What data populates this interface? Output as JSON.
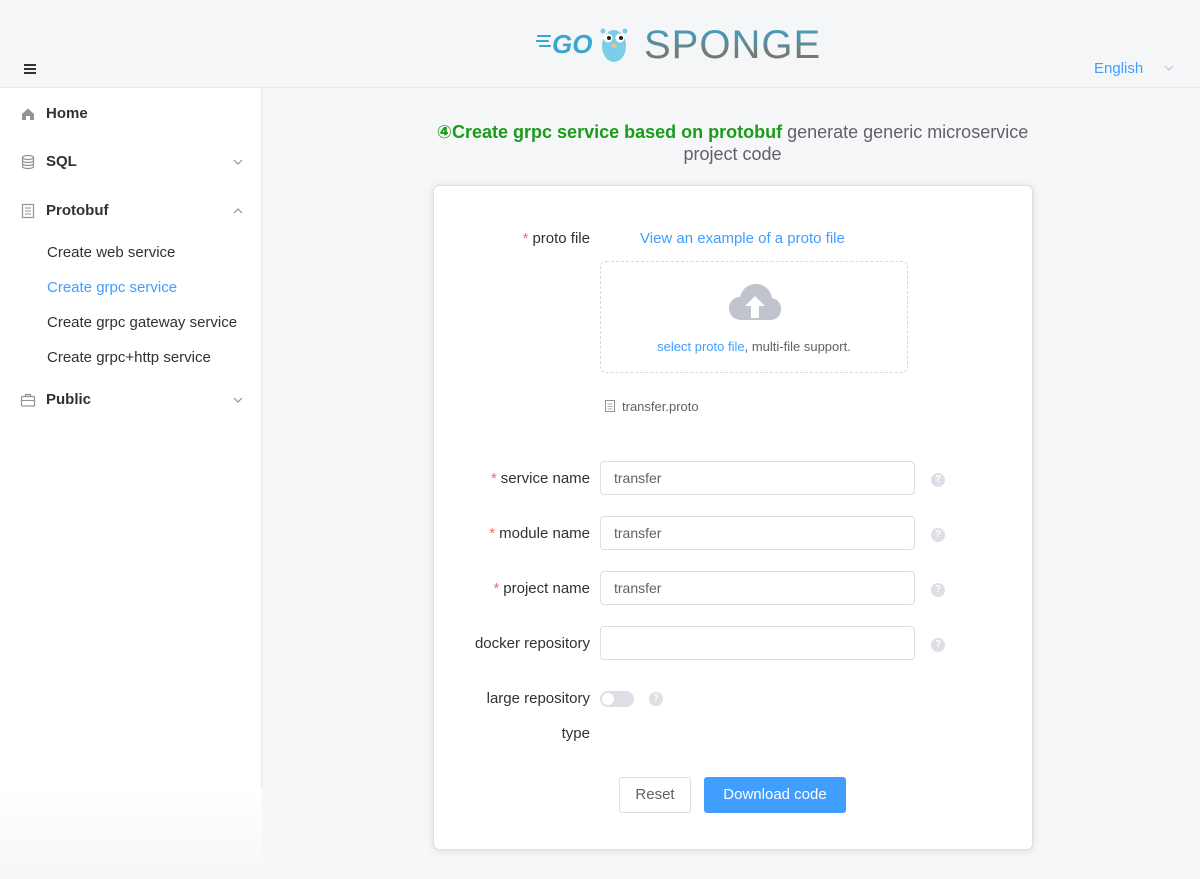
{
  "header": {
    "logo": {
      "go_text": "GO",
      "brand_text": "SPONGE"
    },
    "language": "English"
  },
  "sidebar": {
    "items": [
      {
        "label": "Home",
        "icon": "home-icon"
      },
      {
        "label": "SQL",
        "icon": "database-icon",
        "expanded": false
      },
      {
        "label": "Protobuf",
        "icon": "document-icon",
        "expanded": true,
        "children": [
          {
            "label": "Create web service"
          },
          {
            "label": "Create grpc service",
            "active": true
          },
          {
            "label": "Create grpc gateway service"
          },
          {
            "label": "Create grpc+http service"
          }
        ]
      },
      {
        "label": "Public",
        "icon": "briefcase-icon",
        "expanded": false
      }
    ]
  },
  "main": {
    "heading_highlight": "④Create grpc service based on protobuf",
    "heading_rest": " generate generic microservice project code",
    "form": {
      "proto_file_label": "proto file",
      "example_link": "View an example of a proto file",
      "upload_link": "select proto file",
      "upload_hint": ", multi-file support.",
      "uploaded_file": "transfer.proto",
      "service_name_label": "service name",
      "service_name_value": "transfer",
      "module_name_label": "module name",
      "module_name_value": "transfer",
      "project_name_label": "project name",
      "project_name_value": "transfer",
      "docker_repository_label": "docker repository",
      "docker_repository_value": "",
      "large_repository_label_1": "large repository",
      "large_repository_label_2": "type",
      "large_repository_enabled": false,
      "help_glyph": "?",
      "required_mark": "*"
    },
    "buttons": {
      "reset": "Reset",
      "download": "Download code"
    }
  },
  "colors": {
    "accent": "#409eff",
    "heading_green": "#1a9b1a",
    "required": "#f56c6c",
    "logo_blue": "#3aa6d4",
    "logo_brown": "#8a6a4e"
  }
}
